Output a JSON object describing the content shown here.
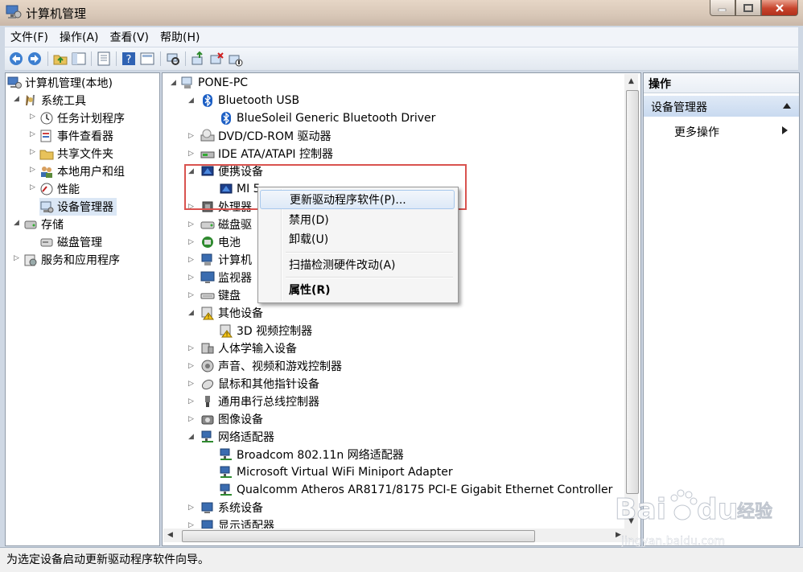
{
  "window": {
    "title": "计算机管理"
  },
  "menu": [
    "文件(F)",
    "操作(A)",
    "查看(V)",
    "帮助(H)"
  ],
  "left_tree": [
    {
      "label": "计算机管理(本地)"
    },
    {
      "label": "系统工具"
    },
    {
      "label": "任务计划程序"
    },
    {
      "label": "事件查看器"
    },
    {
      "label": "共享文件夹"
    },
    {
      "label": "本地用户和组"
    },
    {
      "label": "性能"
    },
    {
      "label": "设备管理器"
    },
    {
      "label": "存储"
    },
    {
      "label": "磁盘管理"
    },
    {
      "label": "服务和应用程序"
    }
  ],
  "device_tree": [
    {
      "label": "PONE-PC"
    },
    {
      "label": "Bluetooth USB"
    },
    {
      "label": "BlueSoleil Generic Bluetooth Driver"
    },
    {
      "label": "DVD/CD-ROM 驱动器"
    },
    {
      "label": "IDE ATA/ATAPI 控制器"
    },
    {
      "label": "便携设备"
    },
    {
      "label": "MI 5"
    },
    {
      "label": "处理器"
    },
    {
      "label": "磁盘驱"
    },
    {
      "label": "电池"
    },
    {
      "label": "计算机"
    },
    {
      "label": "监视器"
    },
    {
      "label": "键盘"
    },
    {
      "label": "其他设备"
    },
    {
      "label": "3D 视频控制器"
    },
    {
      "label": "人体学输入设备"
    },
    {
      "label": "声音、视频和游戏控制器"
    },
    {
      "label": "鼠标和其他指针设备"
    },
    {
      "label": "通用串行总线控制器"
    },
    {
      "label": "图像设备"
    },
    {
      "label": "网络适配器"
    },
    {
      "label": "Broadcom 802.11n 网络适配器"
    },
    {
      "label": "Microsoft Virtual WiFi Miniport Adapter"
    },
    {
      "label": "Qualcomm Atheros AR8171/8175 PCI-E Gigabit Ethernet Controller"
    },
    {
      "label": "系统设备"
    },
    {
      "label": "显示适配器"
    }
  ],
  "context_menu": {
    "update_driver": "更新驱动程序软件(P)...",
    "disable": "禁用(D)",
    "uninstall": "卸载(U)",
    "scan": "扫描检测硬件改动(A)",
    "properties": "属性(R)"
  },
  "actions_pane": {
    "header": "操作",
    "section": "设备管理器",
    "more": "更多操作"
  },
  "status_bar": "为选定设备启动更新驱动程序软件向导。",
  "watermark": {
    "brand": "Bai du 经验",
    "url": "jingyan.baidu.com"
  },
  "colors": {
    "selection": "#dbe7f5",
    "highlight_box": "#d9534f",
    "actions_section": "#c9daf0"
  }
}
